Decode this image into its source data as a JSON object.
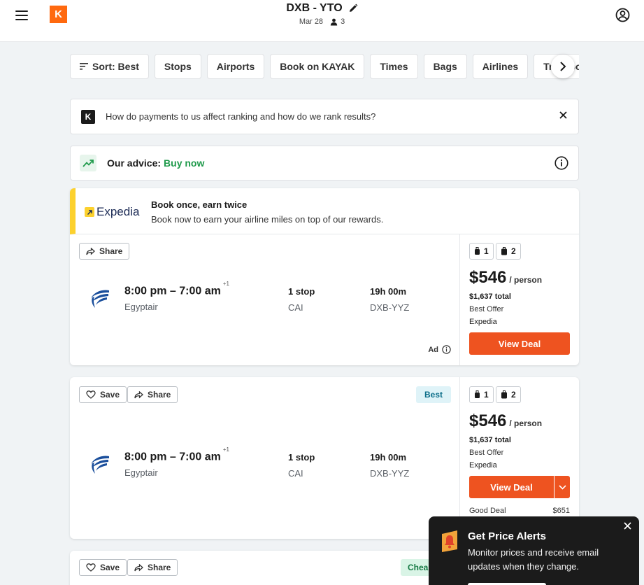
{
  "header": {
    "route": "DXB - YTO",
    "date": "Mar 28",
    "travelers": "3"
  },
  "filters": [
    "Sort: Best",
    "Stops",
    "Airports",
    "Book on KAYAK",
    "Times",
    "Bags",
    "Airlines",
    "Transportation"
  ],
  "info_banner": {
    "badge": "K",
    "text": "How do payments to us affect ranking and how do we rank results?"
  },
  "advice": {
    "label": "Our advice:",
    "value": "Buy now"
  },
  "colors": {
    "brand": "#ff690f",
    "deal_button": "#ee5320",
    "advice_green": "#1f9a4b",
    "sponsor_yellow": "#fcd12e"
  },
  "sponsored": {
    "provider_logo": "Expedia",
    "title": "Book once, earn twice",
    "subtitle": "Book now to earn your airline miles on top of our rewards.",
    "share_label": "Share",
    "times": "8:00 pm – 7:00 am",
    "day_offset": "+1",
    "airline": "Egyptair",
    "stops": "1 stop",
    "via": "CAI",
    "duration": "19h 00m",
    "airports": "DXB-YYZ",
    "ad_label": "Ad",
    "carry_on": "1",
    "checked": "2",
    "price": "$546",
    "per": "/ person",
    "total": "$1,637 total",
    "offer": "Best Offer",
    "provider": "Expedia",
    "cta": "View Deal"
  },
  "result1": {
    "save_label": "Save",
    "share_label": "Share",
    "badge": "Best",
    "times": "8:00 pm – 7:00 am",
    "day_offset": "+1",
    "airline": "Egyptair",
    "stops": "1 stop",
    "via": "CAI",
    "duration": "19h 00m",
    "airports": "DXB-YYZ",
    "carry_on": "1",
    "checked": "2",
    "price": "$546",
    "per": "/ person",
    "total": "$1,637 total",
    "offer": "Best Offer",
    "provider": "Expedia",
    "cta": "View Deal",
    "alt_label": "Good Deal",
    "alt_price": "$651"
  },
  "result2": {
    "save_label": "Save",
    "share_label": "Share",
    "badge": "Chea"
  },
  "price_alert": {
    "title": "Get Price Alerts",
    "text": "Monitor prices and receive email updates when they change."
  }
}
